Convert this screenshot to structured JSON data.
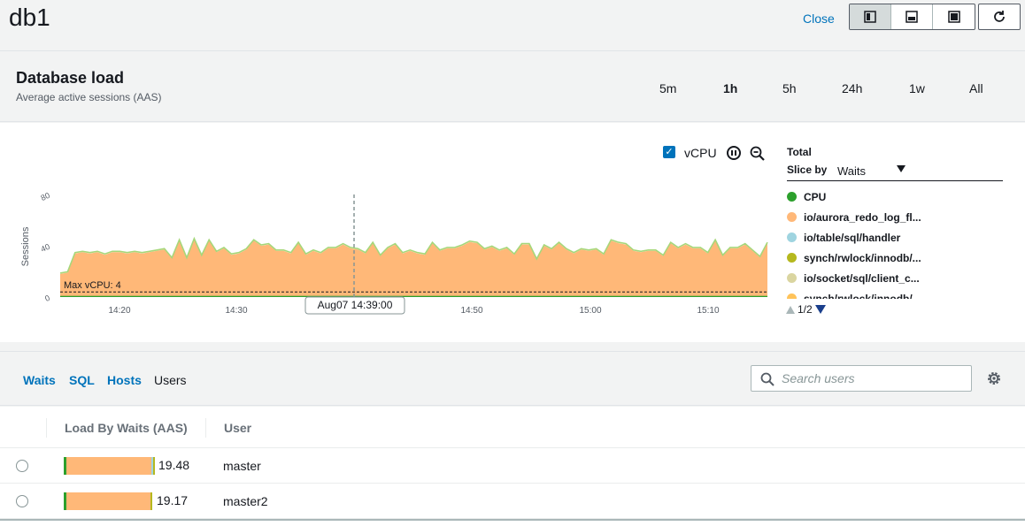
{
  "header": {
    "title": "db1",
    "close_label": "Close"
  },
  "load": {
    "title": "Database load",
    "subtitle": "Average active sessions (AAS)",
    "ranges": [
      "5m",
      "1h",
      "5h",
      "24h",
      "1w",
      "All"
    ],
    "active_range": "1h"
  },
  "controls": {
    "vcpu_label": "vCPU",
    "vcpu_checked": true
  },
  "legend": {
    "total_label": "Total",
    "slice_label": "Slice by",
    "slice_value": "Waits",
    "items": [
      {
        "label": "CPU",
        "color": "#2ca02c"
      },
      {
        "label": "io/aurora_redo_log_fl...",
        "color": "#ffb878"
      },
      {
        "label": "io/table/sql/handler",
        "color": "#9fd4e0"
      },
      {
        "label": "synch/rwlock/innodb/...",
        "color": "#b5b81e"
      },
      {
        "label": "io/socket/sql/client_c...",
        "color": "#dad5a0"
      },
      {
        "label": "synch/rwlock/innodb/...",
        "color": "#ffc35a"
      }
    ],
    "pager": "1/2"
  },
  "chart_data": {
    "type": "area",
    "ylabel": "Sessions",
    "yticks": [
      "0",
      "40",
      "80"
    ],
    "ylim": [
      0,
      80
    ],
    "xticks": [
      "14:20",
      "14:30",
      "14:40",
      "14:50",
      "15:00",
      "15:10"
    ],
    "max_vcpu_label": "Max vCPU: 4",
    "max_vcpu_value": 4,
    "tooltip": "Aug07 14:39:00",
    "series": [
      {
        "name": "io/aurora_redo_log_fl...",
        "color": "#ffb878",
        "values": [
          18,
          19,
          34,
          35,
          34,
          35,
          33,
          35,
          35,
          34,
          35,
          34,
          35,
          36,
          37,
          30,
          44,
          30,
          45,
          32,
          44,
          35,
          38,
          33,
          34,
          37,
          44,
          40,
          41,
          36,
          36,
          34,
          42,
          33,
          36,
          34,
          38,
          38,
          41,
          38,
          37,
          34,
          42,
          32,
          38,
          41,
          34,
          36,
          34,
          33,
          42,
          36,
          38,
          38,
          40,
          43,
          42,
          37,
          39,
          36,
          38,
          33,
          41,
          41,
          29,
          40,
          37,
          42,
          37,
          34,
          37,
          36,
          37,
          33,
          44,
          42,
          41,
          36,
          35,
          36,
          36,
          32,
          42,
          38,
          41,
          38,
          38,
          34,
          44,
          32,
          38,
          38,
          41,
          36,
          31,
          42
        ]
      },
      {
        "name": "CPU",
        "color": "#2ca02c",
        "values": [
          0.3,
          0.3,
          0.3,
          0.3,
          0.3,
          0.3,
          0.3,
          0.3,
          0.3,
          0.3,
          0.3,
          0.3,
          0.3,
          0.3,
          0.3,
          0.3,
          0.3,
          0.3,
          0.3,
          0.3,
          0.3,
          0.3,
          0.3,
          0.3,
          0.3,
          0.3,
          0.3,
          0.3,
          0.3,
          0.3,
          0.3,
          0.3,
          0.3,
          0.3,
          0.3,
          0.3,
          0.3,
          0.3,
          0.3,
          0.3,
          0.3,
          0.3,
          0.3,
          0.3,
          0.3,
          0.3,
          0.3,
          0.3,
          0.3,
          0.3,
          0.3,
          0.3,
          0.3,
          0.3,
          0.3,
          0.3,
          0.3,
          0.3,
          0.3,
          0.3,
          0.3,
          0.3,
          0.3,
          0.3,
          0.3,
          0.3,
          0.3,
          0.3,
          0.3,
          0.3,
          0.3,
          0.3,
          0.3,
          0.3,
          0.3,
          0.3,
          0.3,
          0.3,
          0.3,
          0.3,
          0.3,
          0.3,
          0.3,
          0.3,
          0.3,
          0.3,
          0.3,
          0.3,
          0.3,
          0.3,
          0.3,
          0.3,
          0.3,
          0.3,
          0.3,
          0.3
        ]
      }
    ]
  },
  "tabs": [
    "Waits",
    "SQL",
    "Hosts",
    "Users"
  ],
  "active_tab": "Users",
  "search": {
    "placeholder": "Search users",
    "value": ""
  },
  "table": {
    "columns": [
      "Load By Waits (AAS)",
      "User"
    ],
    "rows": [
      {
        "load": "19.48",
        "load_value": 19.48,
        "user": "master"
      },
      {
        "load": "19.17",
        "load_value": 19.17,
        "user": "master2"
      }
    ]
  }
}
